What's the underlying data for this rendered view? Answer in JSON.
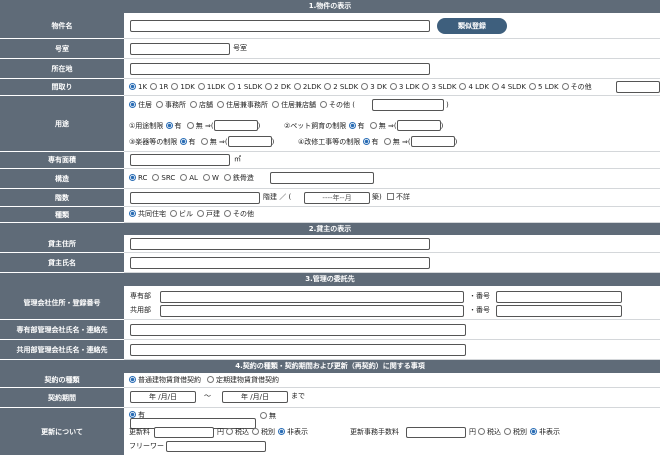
{
  "sections": {
    "s1": "1.物件の表示",
    "s2": "2.貸主の表示",
    "s3": "3.管理の委託先",
    "s4": "4.契約の種類・契約期間および更新（再契約）に関する事項"
  },
  "labels": {
    "bukken": "物件名",
    "goshitsu": "号室",
    "shozaichi": "所在地",
    "madori": "間取り",
    "yoto": "用途",
    "menseki": "専有面積",
    "kozo": "構造",
    "kaisu": "階数",
    "shurui": "種類",
    "kashinushi_addr": "貸主住所",
    "kashinushi_name": "貸主氏名",
    "kanri_addr": "管理会社住所・登録番号",
    "senyu_kanri": "専有部管理会社氏名・連絡先",
    "kyoyo_kanri": "共用部管理会社氏名・連絡先",
    "keiyaku_shurui": "契約の種類",
    "keiyaku_kikan": "契約期間",
    "koshin": "更新について"
  },
  "buttons": {
    "ruiji": "類似登録"
  },
  "suffix": {
    "goshitsu": "号室",
    "menseki": "㎡"
  },
  "madori_options": [
    "1K",
    "1R",
    "1DK",
    "1LDK",
    "1 SLDK",
    "2 DK",
    "2LDK",
    "2 SLDK",
    "3 DK",
    "3 LDK",
    "3 SLDK",
    "4 LDK",
    "4 SLDK",
    "5 LDK",
    "その他"
  ],
  "yoto_options": [
    "住居",
    "事務所",
    "店舗",
    "住居兼事務所",
    "住居兼店舗",
    "その他"
  ],
  "restrictions": {
    "pet_label": "①用途制限",
    "pet2_label": "②ペット飼育の制限",
    "instrument_label": "③楽器等の制限",
    "reno_label": "④改修工事等の制限",
    "yes": "有",
    "no": "無",
    "arrow": "⇒",
    "paren_open": "(",
    "paren_close": ")"
  },
  "kozo_options": [
    "RC",
    "SRC",
    "AL",
    "W",
    "鉄骨造"
  ],
  "kaisu": {
    "kaidate": "階建",
    "slash": "／",
    "date_placeholder": "----年--月",
    "suffix": "築)",
    "fusho": "不詳"
  },
  "shurui_options": [
    "共同住宅",
    "ビル",
    "戸建",
    "その他"
  ],
  "kanri": {
    "senyu": "専有部",
    "kyoyo": "共用部",
    "bango": "・番号"
  },
  "keiyaku_options": [
    "普通建物賃貸借契約",
    "定期建物賃貸借契約"
  ],
  "period": {
    "start": "年 /月/日",
    "tilde": "〜",
    "end": "年 /月/日",
    "made": "まで"
  },
  "koshin": {
    "yes": "有",
    "no": "無",
    "fee_label": "更新料",
    "yen": "円",
    "tax_options": [
      "税込",
      "税別",
      "非表示"
    ],
    "jimu_label": "更新事務手数料",
    "free_label": "フリーワード"
  },
  "colors": {
    "header_bg": "#5f6b78",
    "button_bg": "#3e5f7d",
    "radio_on": "#2a6db5"
  }
}
